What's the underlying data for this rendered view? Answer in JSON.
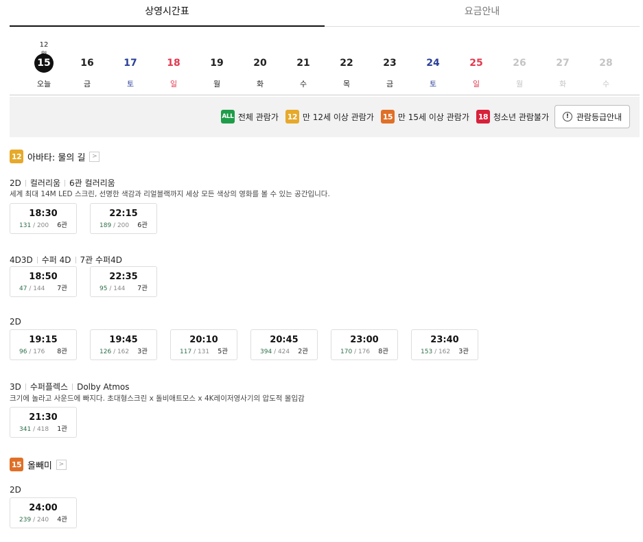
{
  "tabs": [
    {
      "label": "상영시간표",
      "active": true
    },
    {
      "label": "요금안내",
      "active": false
    }
  ],
  "dates": {
    "month": "12월",
    "items": [
      {
        "num": "15",
        "day": "오늘",
        "type": "today"
      },
      {
        "num": "16",
        "day": "금",
        "type": "normal"
      },
      {
        "num": "17",
        "day": "토",
        "type": "sat"
      },
      {
        "num": "18",
        "day": "일",
        "type": "sun"
      },
      {
        "num": "19",
        "day": "월",
        "type": "normal"
      },
      {
        "num": "20",
        "day": "화",
        "type": "normal"
      },
      {
        "num": "21",
        "day": "수",
        "type": "normal"
      },
      {
        "num": "22",
        "day": "목",
        "type": "normal"
      },
      {
        "num": "23",
        "day": "금",
        "type": "normal"
      },
      {
        "num": "24",
        "day": "토",
        "type": "sat"
      },
      {
        "num": "25",
        "day": "일",
        "type": "sun"
      },
      {
        "num": "26",
        "day": "월",
        "type": "dis"
      },
      {
        "num": "27",
        "day": "화",
        "type": "dis"
      },
      {
        "num": "28",
        "day": "수",
        "type": "dis"
      }
    ]
  },
  "ratings": {
    "all_badge": "ALL",
    "all_label": "전체 관람가",
    "r12_badge": "12",
    "r12_label": "만 12세 이상 관람가",
    "r15_badge": "15",
    "r15_label": "만 15세 이상 관람가",
    "r18_badge": "18",
    "r18_label": "청소년 관람불가",
    "guide_button": "관람등급안내",
    "guide_icon": "!"
  },
  "colors": {
    "all": "#1f9c49",
    "r12": "#e6a92a",
    "r15": "#e07027",
    "r18": "#d8213a",
    "sat": "#2a3f99",
    "sun": "#e3384e"
  },
  "movies": [
    {
      "rating": "12",
      "title": "아바타: 물의 길",
      "arrow": ">",
      "formats": [
        {
          "type": "2D",
          "name": "컬러리움",
          "hall": "6관 컬러리움",
          "desc": "세계 최대 14M LED 스크린, 선명한 색감과 리얼블랙까지 세상 모든 색상의 영화를 볼 수 있는 공간입니다.",
          "times": [
            {
              "time": "18:30",
              "avail": "131",
              "total": "/ 200",
              "screen": "6관"
            },
            {
              "time": "22:15",
              "avail": "189",
              "total": "/ 200",
              "screen": "6관"
            }
          ]
        },
        {
          "type": "4D3D",
          "name": "수퍼 4D",
          "hall": "7관 수퍼4D",
          "desc": "",
          "times": [
            {
              "time": "18:50",
              "avail": "47",
              "total": "/ 144",
              "screen": "7관"
            },
            {
              "time": "22:35",
              "avail": "95",
              "total": "/ 144",
              "screen": "7관"
            }
          ]
        },
        {
          "type": "2D",
          "name": "",
          "hall": "",
          "desc": "",
          "times": [
            {
              "time": "19:15",
              "avail": "96",
              "total": "/ 176",
              "screen": "8관"
            },
            {
              "time": "19:45",
              "avail": "126",
              "total": "/ 162",
              "screen": "3관"
            },
            {
              "time": "20:10",
              "avail": "117",
              "total": "/ 131",
              "screen": "5관"
            },
            {
              "time": "20:45",
              "avail": "394",
              "total": "/ 424",
              "screen": "2관"
            },
            {
              "time": "23:00",
              "avail": "170",
              "total": "/ 176",
              "screen": "8관"
            },
            {
              "time": "23:40",
              "avail": "153",
              "total": "/ 162",
              "screen": "3관"
            }
          ]
        },
        {
          "type": "3D",
          "name": "수퍼플렉스",
          "hall": "Dolby Atmos",
          "desc": "크기에 놀라고 사운드에 빠지다. 초대형스크린 x 돌비애트모스 x 4K레이저영사기의 압도적 몰입감",
          "times": [
            {
              "time": "21:30",
              "avail": "341",
              "total": "/ 418",
              "screen": "1관"
            }
          ]
        }
      ]
    },
    {
      "rating": "15",
      "title": "올빼미",
      "arrow": ">",
      "formats": [
        {
          "type": "2D",
          "name": "",
          "hall": "",
          "desc": "",
          "times": [
            {
              "time": "24:00",
              "avail": "239",
              "total": "/ 240",
              "screen": "4관"
            }
          ]
        }
      ]
    }
  ]
}
